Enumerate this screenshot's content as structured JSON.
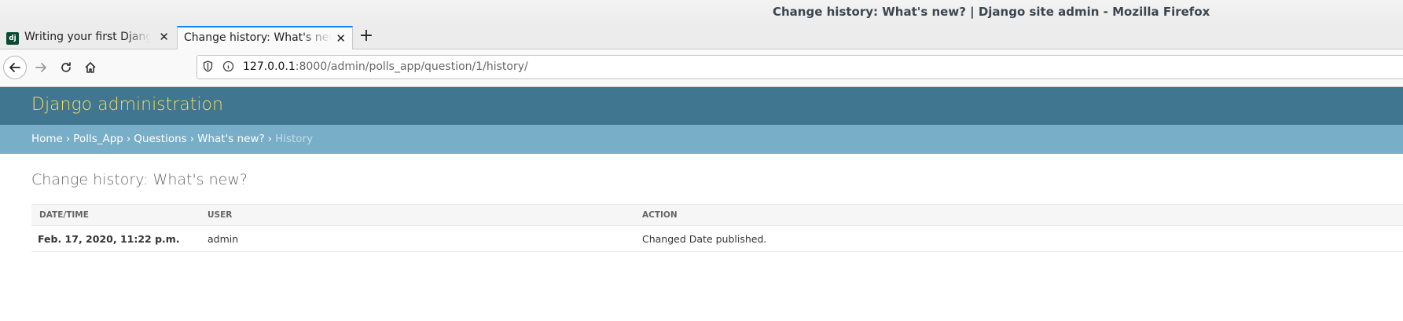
{
  "window": {
    "title": "Change history: What's new? | Django site admin - Mozilla Firefox"
  },
  "tabs": [
    {
      "label": "Writing your first Django app",
      "favicon": "dj"
    },
    {
      "label": "Change history: What's new?"
    }
  ],
  "nav": {
    "url_host": "127.0.0.1",
    "url_rest": ":8000/admin/polls_app/question/1/history/"
  },
  "django": {
    "branding": "Django administration",
    "breadcrumbs": {
      "home": "Home",
      "app": "Polls_App",
      "model": "Questions",
      "object": "What's new?",
      "current": "History",
      "separator": "›"
    },
    "page_title": "Change history: What's new?",
    "table": {
      "headers": {
        "datetime": "Date/time",
        "user": "User",
        "action": "Action"
      },
      "rows": [
        {
          "datetime": "Feb. 17, 2020, 11:22 p.m.",
          "user": "admin",
          "action": "Changed Date published."
        }
      ]
    },
    "colors": {
      "header_bg": "#417690",
      "brand_text": "#f5dd5d",
      "breadcrumb_bg": "#79aec8"
    }
  }
}
